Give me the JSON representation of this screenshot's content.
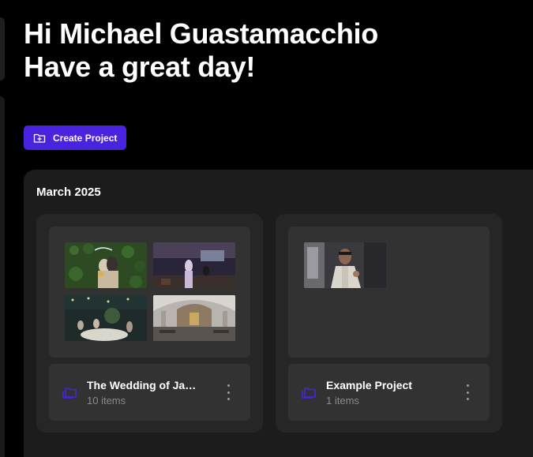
{
  "header": {
    "greeting_line1": "Hi Michael Guastamacchio",
    "greeting_line2": "Have a great day!"
  },
  "actions": {
    "create_project_label": "Create Project",
    "create_project_icon": "folder-plus-icon"
  },
  "groups": [
    {
      "title": "March 2025",
      "projects": [
        {
          "name": "The Wedding of Jami...",
          "count": "10 items",
          "icon": "folder-stack-icon"
        },
        {
          "name": "Example Project",
          "count": "1 items",
          "icon": "folder-stack-icon"
        }
      ]
    }
  ],
  "colors": {
    "accent": "#4a23e0",
    "background": "#000000",
    "panel": "#1c1c1c",
    "card": "#262626",
    "card_inner": "#323232",
    "muted_text": "#8a8a8a"
  }
}
